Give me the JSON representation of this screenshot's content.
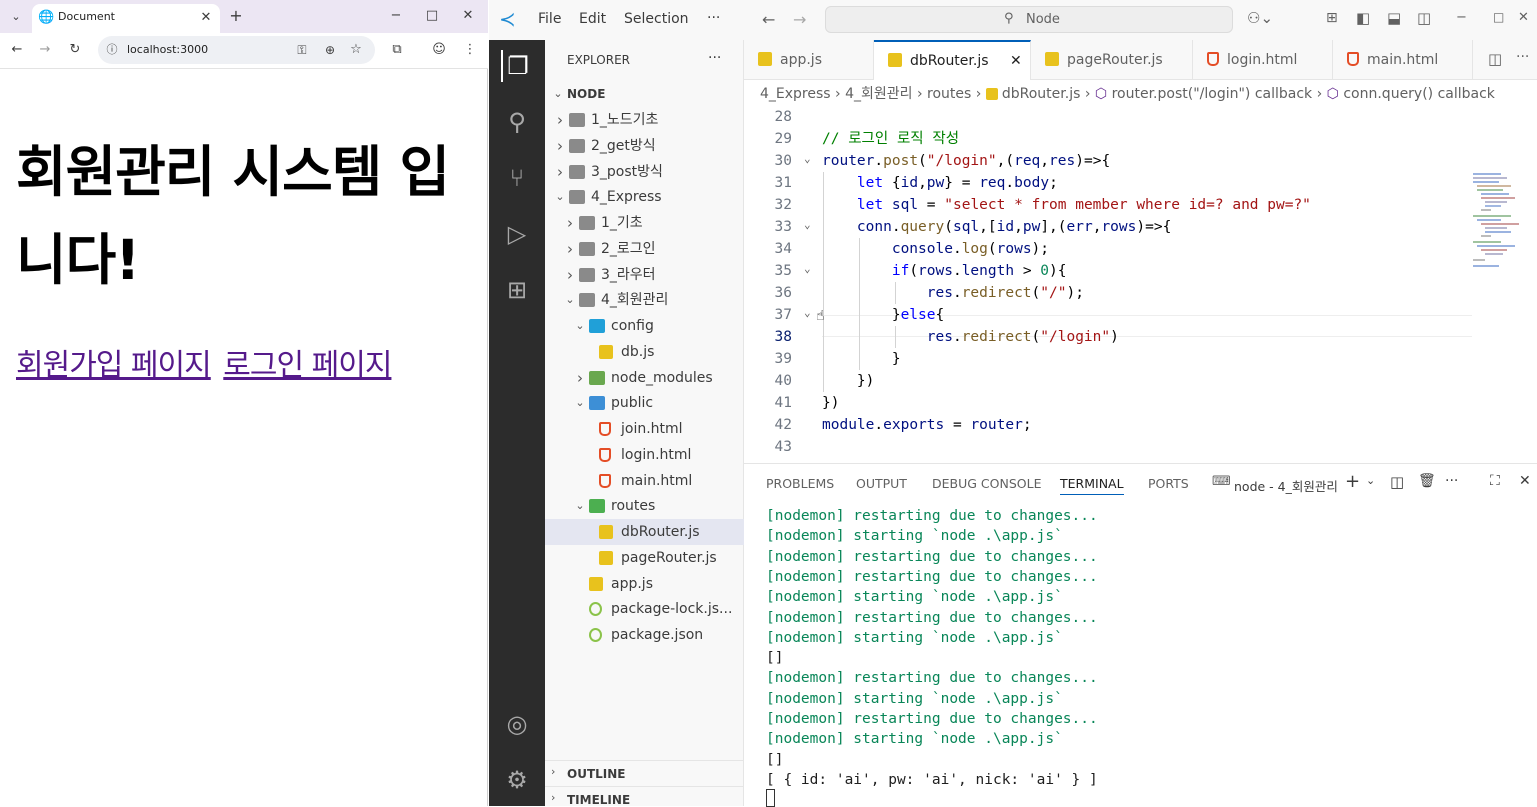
{
  "browser": {
    "tab_title": "Document",
    "url": "localhost:3000",
    "heading": "회원관리 시스템 입니다!",
    "links": [
      "회원가입 페이지",
      "로그인 페이지"
    ]
  },
  "vscode": {
    "menu": [
      "File",
      "Edit",
      "Selection",
      "···"
    ],
    "search_placeholder": "Node",
    "explorer_title": "EXPLORER",
    "explorer_more": "···",
    "root": "NODE",
    "tree": [
      {
        "label": "1_노드기초",
        "type": "folder",
        "level": 1,
        "open": false
      },
      {
        "label": "2_get방식",
        "type": "folder",
        "level": 1,
        "open": false
      },
      {
        "label": "3_post방식",
        "type": "folder",
        "level": 1,
        "open": false
      },
      {
        "label": "4_Express",
        "type": "folder",
        "level": 1,
        "open": true
      },
      {
        "label": "1_기초",
        "type": "folder",
        "level": 2,
        "open": false
      },
      {
        "label": "2_로그인",
        "type": "folder",
        "level": 2,
        "open": false
      },
      {
        "label": "3_라우터",
        "type": "folder",
        "level": 2,
        "open": false
      },
      {
        "label": "4_회원관리",
        "type": "folder",
        "level": 2,
        "open": true
      },
      {
        "label": "config",
        "type": "folder-config",
        "level": 3,
        "open": true
      },
      {
        "label": "db.js",
        "type": "js",
        "level": 4
      },
      {
        "label": "node_modules",
        "type": "folder-node",
        "level": 3,
        "open": false
      },
      {
        "label": "public",
        "type": "folder-public",
        "level": 3,
        "open": true
      },
      {
        "label": "join.html",
        "type": "html",
        "level": 4
      },
      {
        "label": "login.html",
        "type": "html",
        "level": 4
      },
      {
        "label": "main.html",
        "type": "html",
        "level": 4
      },
      {
        "label": "routes",
        "type": "folder-routes",
        "level": 3,
        "open": true
      },
      {
        "label": "dbRouter.js",
        "type": "js",
        "level": 4,
        "selected": true
      },
      {
        "label": "pageRouter.js",
        "type": "js",
        "level": 4
      },
      {
        "label": "app.js",
        "type": "js",
        "level": 3
      },
      {
        "label": "package-lock.js...",
        "type": "json",
        "level": 3
      },
      {
        "label": "package.json",
        "type": "json",
        "level": 3
      }
    ],
    "outline": "OUTLINE",
    "timeline": "TIMELINE",
    "tabs": [
      {
        "label": "app.js",
        "type": "js"
      },
      {
        "label": "dbRouter.js",
        "type": "js",
        "active": true
      },
      {
        "label": "pageRouter.js",
        "type": "js"
      },
      {
        "label": "login.html",
        "type": "html"
      },
      {
        "label": "main.html",
        "type": "html"
      }
    ],
    "breadcrumbs": [
      "4_Express",
      "4_회원관리",
      "routes",
      "dbRouter.js",
      "router.post(\"/login\") callback",
      "conn.query() callback"
    ],
    "line_numbers": [
      "28",
      "29",
      "30",
      "31",
      "32",
      "33",
      "34",
      "35",
      "36",
      "37",
      "38",
      "39",
      "40",
      "41",
      "42",
      "43"
    ],
    "code": [
      "",
      "// 로그인 로직 작성",
      "router.post(\"/login\",(req,res)=>{",
      "    let {id,pw} = req.body;",
      "    let sql = \"select * from member where id=? and pw=?\"",
      "    conn.query(sql,[id,pw],(err,rows)=>{",
      "        console.log(rows);",
      "        if(rows.length > 0){",
      "            res.redirect(\"/\");",
      "        }else{",
      "            res.redirect(\"/login\")",
      "        }",
      "    })",
      "})",
      "module.exports = router;",
      ""
    ],
    "panel_tabs": [
      "PROBLEMS",
      "OUTPUT",
      "DEBUG CONSOLE",
      "TERMINAL",
      "PORTS"
    ],
    "terminal_name": "node - 4_회원관리",
    "terminal_lines": [
      "[nodemon] restarting due to changes...",
      "[nodemon] starting `node .\\app.js`",
      "[nodemon] restarting due to changes...",
      "[nodemon] restarting due to changes...",
      "[nodemon] starting `node .\\app.js`",
      "[nodemon] restarting due to changes...",
      "[nodemon] starting `node .\\app.js`",
      "[]",
      "[nodemon] restarting due to changes...",
      "[nodemon] starting `node .\\app.js`",
      "[nodemon] restarting due to changes...",
      "[nodemon] starting `node .\\app.js`",
      "[]",
      "[ { id: 'ai', pw: 'ai', nick: 'ai' } ]"
    ]
  }
}
